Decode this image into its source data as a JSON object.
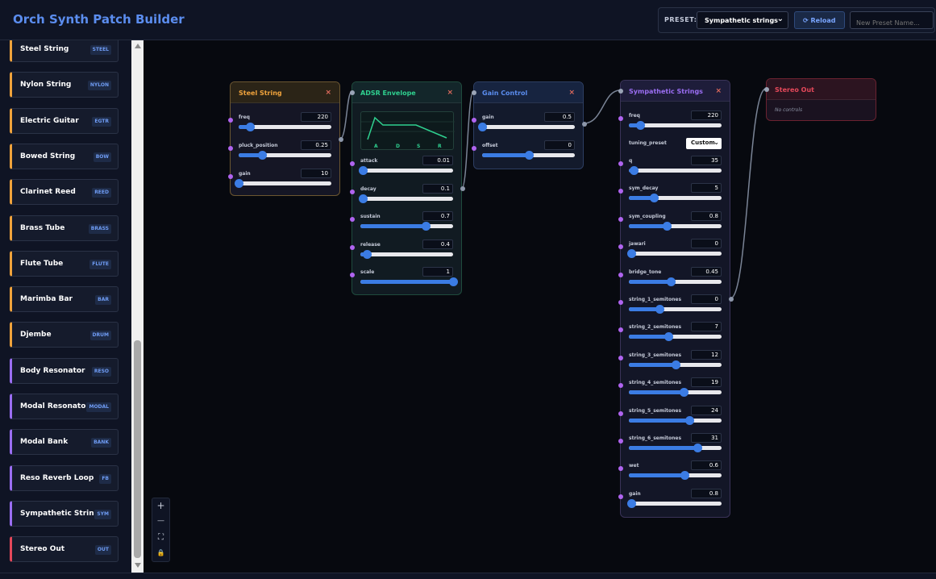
{
  "header": {
    "title": "Orch Synth Patch Builder",
    "preset_label": "PRESET:",
    "preset_value": "Sympathetic strings",
    "reload_label": "Reload",
    "new_preset_placeholder": "New Preset Name..."
  },
  "sidebar": {
    "items": [
      {
        "label": "Steel String",
        "tag": "STEEL",
        "color": "#f0a33c"
      },
      {
        "label": "Nylon String",
        "tag": "NYLON",
        "color": "#f0a33c"
      },
      {
        "label": "Electric Guitar",
        "tag": "EGTR",
        "color": "#f0a33c"
      },
      {
        "label": "Bowed String",
        "tag": "BOW",
        "color": "#f0a33c"
      },
      {
        "label": "Clarinet Reed",
        "tag": "REED",
        "color": "#f0a33c"
      },
      {
        "label": "Brass Tube",
        "tag": "BRASS",
        "color": "#f0a33c"
      },
      {
        "label": "Flute Tube",
        "tag": "FLUTE",
        "color": "#f0a33c"
      },
      {
        "label": "Marimba Bar",
        "tag": "BAR",
        "color": "#f0a33c"
      },
      {
        "label": "Djembe",
        "tag": "DRUM",
        "color": "#f0a33c"
      },
      {
        "label": "Body Resonator",
        "tag": "RESO",
        "color": "#9b6ef3"
      },
      {
        "label": "Modal Resonator",
        "tag": "MODAL",
        "color": "#9b6ef3"
      },
      {
        "label": "Modal Bank",
        "tag": "BANK",
        "color": "#9b6ef3"
      },
      {
        "label": "Reso Reverb Loop",
        "tag": "FB",
        "color": "#9b6ef3"
      },
      {
        "label": "Sympathetic Strings",
        "tag": "SYM",
        "color": "#9b6ef3"
      },
      {
        "label": "Stereo Out",
        "tag": "OUT",
        "color": "#e4485a"
      }
    ]
  },
  "nodes": {
    "steel": {
      "title": "Steel String",
      "accent": "#f0a33c",
      "close": "×",
      "params": [
        {
          "label": "freq",
          "value": "220",
          "fraction": 0.12
        },
        {
          "label": "pluck_position",
          "value": "0.25",
          "fraction": 0.25
        },
        {
          "label": "gain",
          "value": "10",
          "fraction": 0.0
        }
      ]
    },
    "adsr": {
      "title": "ADSR Envelope",
      "accent": "#2fd08f",
      "close": "×",
      "env_letters": [
        "A",
        "D",
        "S",
        "R"
      ],
      "params": [
        {
          "label": "attack",
          "value": "0.01",
          "fraction": 0.03
        },
        {
          "label": "decay",
          "value": "0.1",
          "fraction": 0.03
        },
        {
          "label": "sustain",
          "value": "0.7",
          "fraction": 0.7
        },
        {
          "label": "release",
          "value": "0.4",
          "fraction": 0.07
        },
        {
          "label": "scale",
          "value": "1",
          "fraction": 1.0
        }
      ]
    },
    "gain": {
      "title": "Gain Control",
      "accent": "#5b8def",
      "close": "×",
      "params": [
        {
          "label": "gain",
          "value": "0.5",
          "fraction": 0.0
        },
        {
          "label": "offset",
          "value": "0",
          "fraction": 0.5
        }
      ]
    },
    "sym": {
      "title": "Sympathetic Strings",
      "accent": "#9b6ef3",
      "close": "×",
      "tuning_label": "tuning_preset",
      "tuning_value": "Custom",
      "params_top": [
        {
          "label": "freq",
          "value": "220",
          "fraction": 0.12
        }
      ],
      "params": [
        {
          "label": "q",
          "value": "35",
          "fraction": 0.05
        },
        {
          "label": "sym_decay",
          "value": "5",
          "fraction": 0.27
        },
        {
          "label": "sym_coupling",
          "value": "0.8",
          "fraction": 0.41
        },
        {
          "label": "jawari",
          "value": "0",
          "fraction": 0.03
        },
        {
          "label": "bridge_tone",
          "value": "0.45",
          "fraction": 0.45
        },
        {
          "label": "string_1_semitones",
          "value": "0",
          "fraction": 0.33
        },
        {
          "label": "string_2_semitones",
          "value": "7",
          "fraction": 0.43
        },
        {
          "label": "string_3_semitones",
          "value": "12",
          "fraction": 0.5
        },
        {
          "label": "string_4_semitones",
          "value": "19",
          "fraction": 0.59
        },
        {
          "label": "string_5_semitones",
          "value": "24",
          "fraction": 0.65
        },
        {
          "label": "string_6_semitones",
          "value": "31",
          "fraction": 0.74
        },
        {
          "label": "wet",
          "value": "0.6",
          "fraction": 0.6
        },
        {
          "label": "gain",
          "value": "0.8",
          "fraction": 0.03
        }
      ]
    },
    "out": {
      "title": "Stereo Out",
      "accent": "#e4485a",
      "no_controls": "No controls"
    }
  },
  "zoom": {
    "zoom_in": "+",
    "zoom_out": "—",
    "fit": "⛶",
    "lock": "🔒"
  }
}
